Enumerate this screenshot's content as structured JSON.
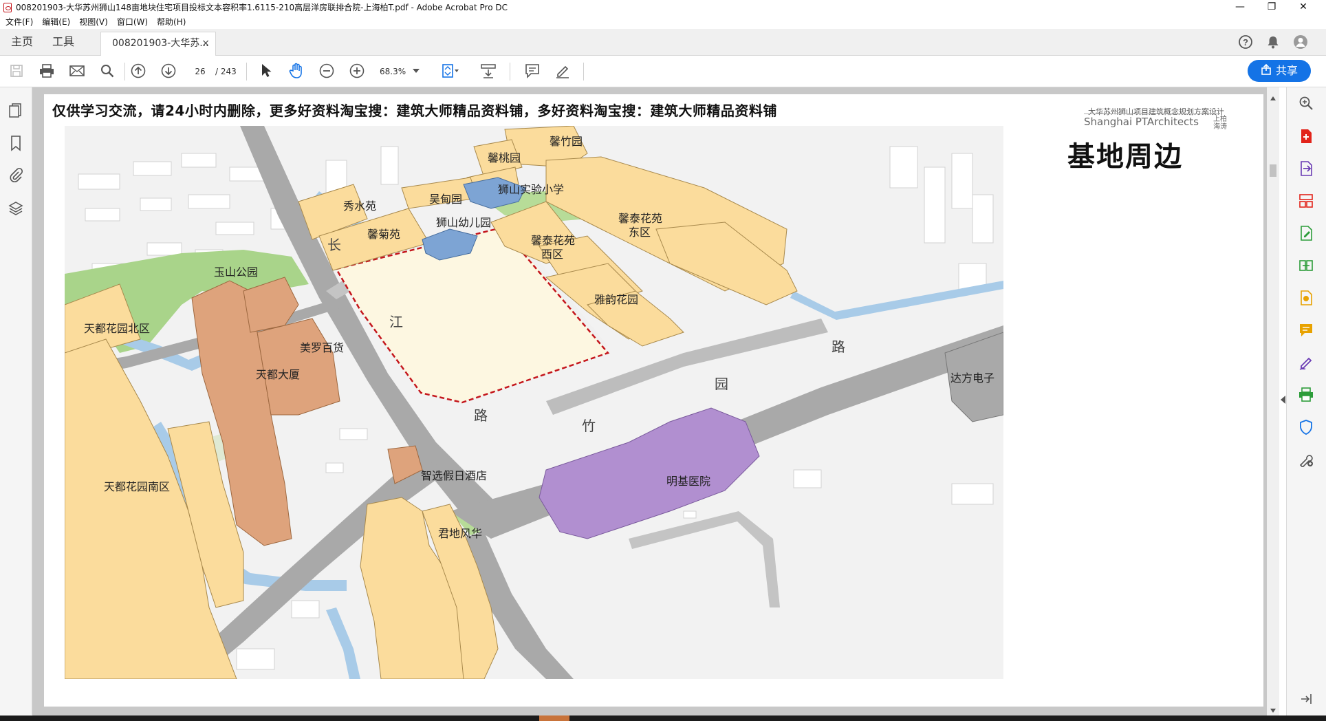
{
  "window": {
    "title": "008201903-大华苏州狮山148亩地块住宅项目投标文本容积率1.6115-210高层洋房联排合院-上海柏T.pdf - Adobe Acrobat Pro DC",
    "controls": {
      "minimize": "—",
      "maximize": "❐",
      "close": "✕"
    }
  },
  "menu": [
    "文件(F)",
    "编辑(E)",
    "视图(V)",
    "窗口(W)",
    "帮助(H)"
  ],
  "tabs": {
    "home": "主页",
    "tools": "工具",
    "doc": "008201903-大华苏...",
    "close": "×"
  },
  "toolbar": {
    "page_current": "26",
    "page_total": "/ 243",
    "zoom": "68.3%",
    "share_label": "共享"
  },
  "page": {
    "banner": "仅供学习交流，请24小时内删除，更多好资料淘宝搜：建筑大师精品资料铺，多好资料淘宝搜：建筑大师精品资料铺",
    "title": "基地周边",
    "firm_cn": "大华苏州狮山项目建筑概念规划方案设计",
    "firm_en": "Shanghai PTArchitects",
    "firm_mark_line1": "上柏",
    "firm_mark_line2": "海涛"
  },
  "map": {
    "labels": {
      "xinzhuyuan": "馨竹园",
      "xintaoyuan": "馨桃园",
      "shishan_school": "狮山实验小学",
      "xiushuiyuan": "秀水苑",
      "wudianyuan": "吴甸园",
      "shishan_kindergarten": "狮山幼儿园",
      "xinjuyuan": "馨菊苑",
      "xintai_east_1": "馨泰花苑",
      "xintai_east_2": "东区",
      "xintai_west_1": "馨泰花苑",
      "xintai_west_2": "西区",
      "yunshan_park": "玉山公园",
      "yayun_garden": "雅韵花园",
      "tiandu_north": "天都花园北区",
      "meiluo": "美罗百货",
      "tiandu_tower": "天都大厦",
      "dafang": "达方电子",
      "tiandu_south": "天都花园南区",
      "zhixuan_hotel": "智选假日酒店",
      "mingji_hospital": "明基医院",
      "jundi": "君地风华"
    },
    "roads": {
      "chang": "长",
      "jiang": "江",
      "lu1": "路",
      "lu2": "路",
      "yuan": "园",
      "zhu": "竹"
    },
    "colors": {
      "residential": "#fbdc9c",
      "commercial": "#dea37c",
      "education": "#7da4d4",
      "hospital": "#b18fd0",
      "park": "#a9d48a",
      "site": "#fdf7e1",
      "site_border": "#c4161c",
      "water": "#a8cbe8",
      "road": "#a9a9a9"
    }
  }
}
